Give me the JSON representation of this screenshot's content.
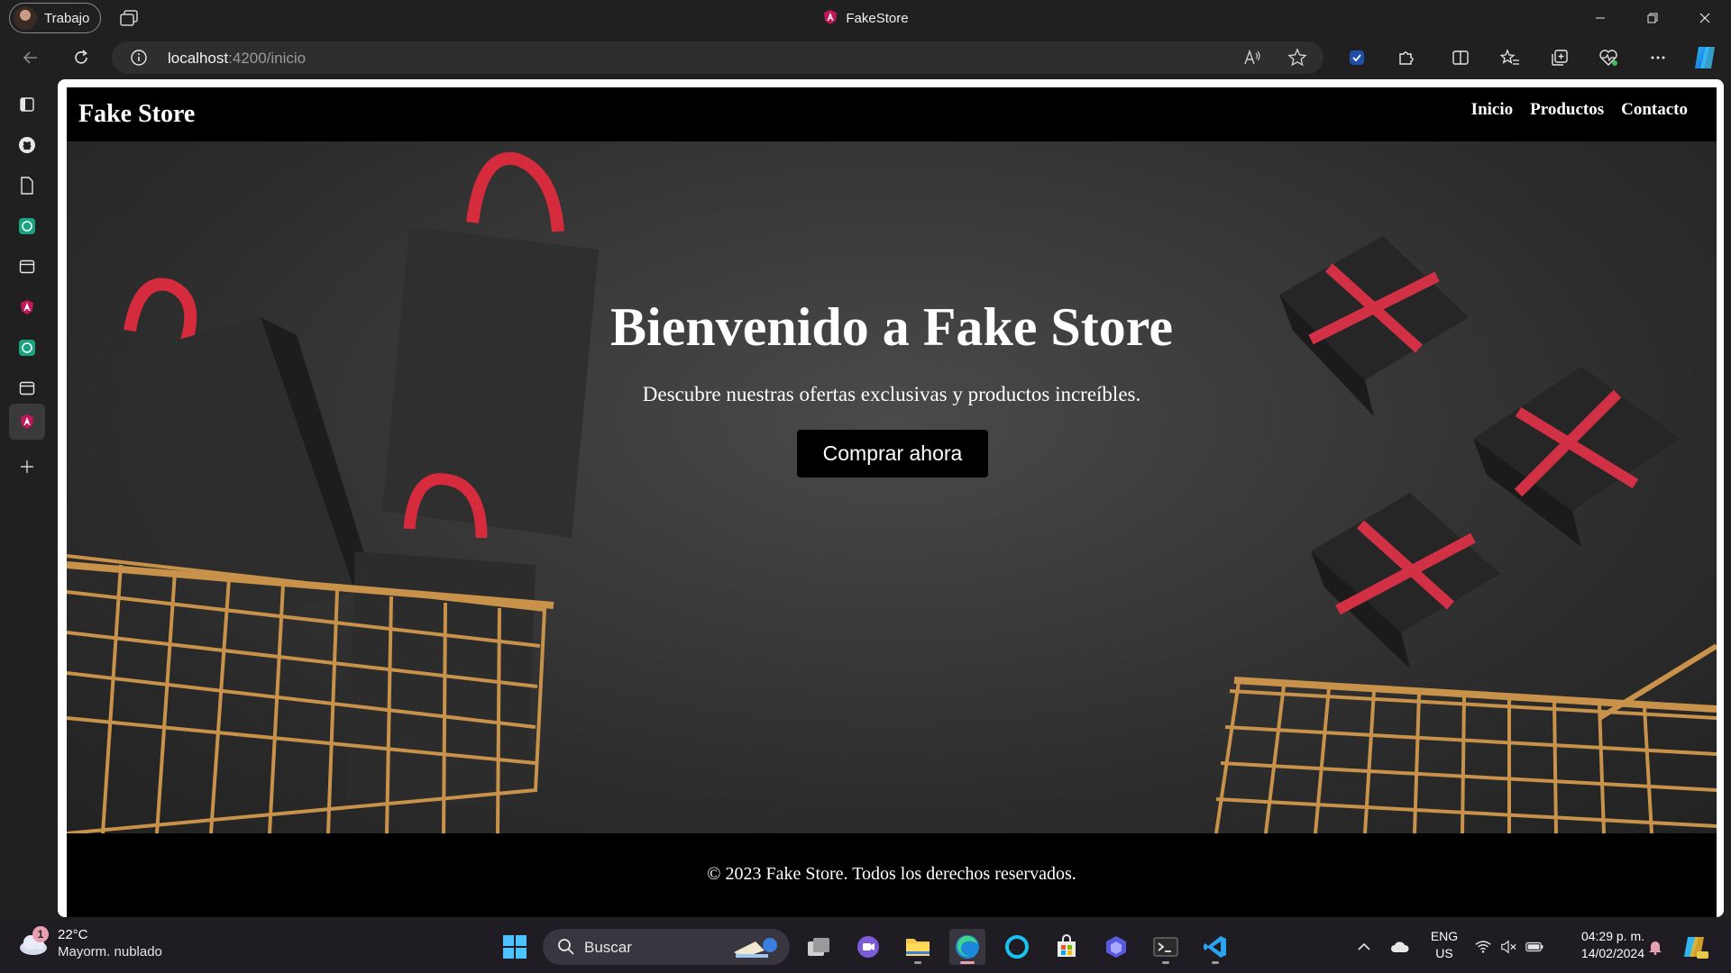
{
  "titlebar": {
    "profile_name": "Trabajo",
    "title": "FakeStore"
  },
  "address_bar": {
    "host": "localhost",
    "path": ":4200/inicio"
  },
  "site": {
    "brand": "Fake Store",
    "nav": [
      {
        "label": "Inicio"
      },
      {
        "label": "Productos"
      },
      {
        "label": "Contacto"
      }
    ],
    "hero": {
      "title": "Bienvenido a Fake Store",
      "subtitle": "Descubre nuestras ofertas exclusivas y productos increíbles.",
      "cta": "Comprar ahora"
    },
    "footer": "© 2023 Fake Store. Todos los derechos reservados."
  },
  "taskbar": {
    "weather": {
      "badge": "1",
      "temp": "22°C",
      "condition": "Mayorm. nublado"
    },
    "search_label": "Buscar",
    "lang": "ENG",
    "region": "US",
    "time": "04:29 p. m.",
    "date": "14/02/2024"
  },
  "colors": {
    "accent": "#e8a0b0",
    "site_bar": "#000000",
    "hero_bg": "#3a3a3a",
    "ribbon_red": "#d23045",
    "cart_gold": "#c8924a"
  }
}
